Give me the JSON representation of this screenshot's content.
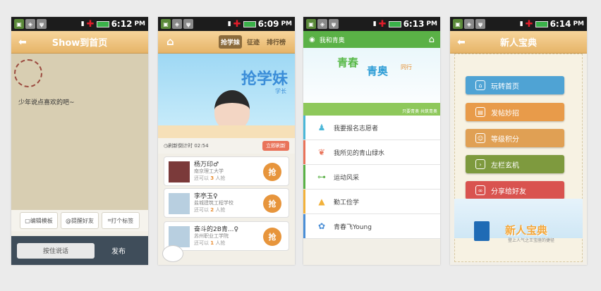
{
  "status": {
    "time": "6:12",
    "ampm": "PM"
  },
  "status2": {
    "time": "6:09",
    "ampm": "PM"
  },
  "status3": {
    "time": "6:13",
    "ampm": "PM"
  },
  "status4": {
    "time": "6:14",
    "ampm": "PM"
  },
  "phone1": {
    "title": "Show到首页",
    "placeholder_text": "少年说点喜欢的吧~",
    "tools": [
      "编辑模板",
      "提醒好友",
      "打个标签"
    ],
    "input_label": "按住说话",
    "send_label": "发布"
  },
  "phone2": {
    "tabs": [
      "抢学妹",
      "征迹",
      "排行榜"
    ],
    "banner_title": "抢学妹",
    "banner_sub": "学长",
    "countdown_label": "刷新倒计时",
    "countdown": "02:54",
    "refresh_btn": "立即刷新",
    "grab_label": "抢",
    "cards": [
      {
        "name": "杨万印♂",
        "school": "南京理工大学",
        "count_prefix": "还可以",
        "count": "3",
        "count_suffix": "人抢"
      },
      {
        "name": "李亭玉♀",
        "school": "盐城建筑工程学校",
        "count_prefix": "还可以",
        "count": "2",
        "count_suffix": "人抢"
      },
      {
        "name": "奋斗的2B青...♀",
        "school": "苏州职业工学院",
        "count_prefix": "还可以",
        "count": "1",
        "count_suffix": "人抢"
      }
    ]
  },
  "phone3": {
    "title": "我和青奥",
    "banner_t1": "青春",
    "banner_t2": "青奥",
    "banner_t3": "同行",
    "banner_caption": "只要青奥 共筑青奥",
    "items": [
      {
        "label": "我要报名志愿者",
        "color": "#4bb7d8",
        "icon": "♟"
      },
      {
        "label": "我所见的青山绿水",
        "color": "#e9735a",
        "icon": "❦"
      },
      {
        "label": "运动风采",
        "color": "#5ab146",
        "icon": "⊶"
      },
      {
        "label": "勤工俭学",
        "color": "#f2b13a",
        "icon": "▲"
      },
      {
        "label": "青春飞Young",
        "color": "#4a8ed6",
        "icon": "✿"
      }
    ]
  },
  "phone4": {
    "title": "新人宝典",
    "buttons": [
      {
        "label": "玩转首页",
        "color": "#4fa3d4",
        "icon": "⌂"
      },
      {
        "label": "发帖妙招",
        "color": "#e89b4a",
        "icon": "▤"
      },
      {
        "label": "等级积分",
        "color": "#e0a054",
        "icon": "☺"
      },
      {
        "label": "左栏玄机",
        "color": "#7e9a3e",
        "icon": "›"
      },
      {
        "label": "分享给好友",
        "color": "#d9534f",
        "icon": "∞"
      }
    ],
    "logo": "新人宝典",
    "logo_sub": "登上人气之王宝座的捷径"
  }
}
